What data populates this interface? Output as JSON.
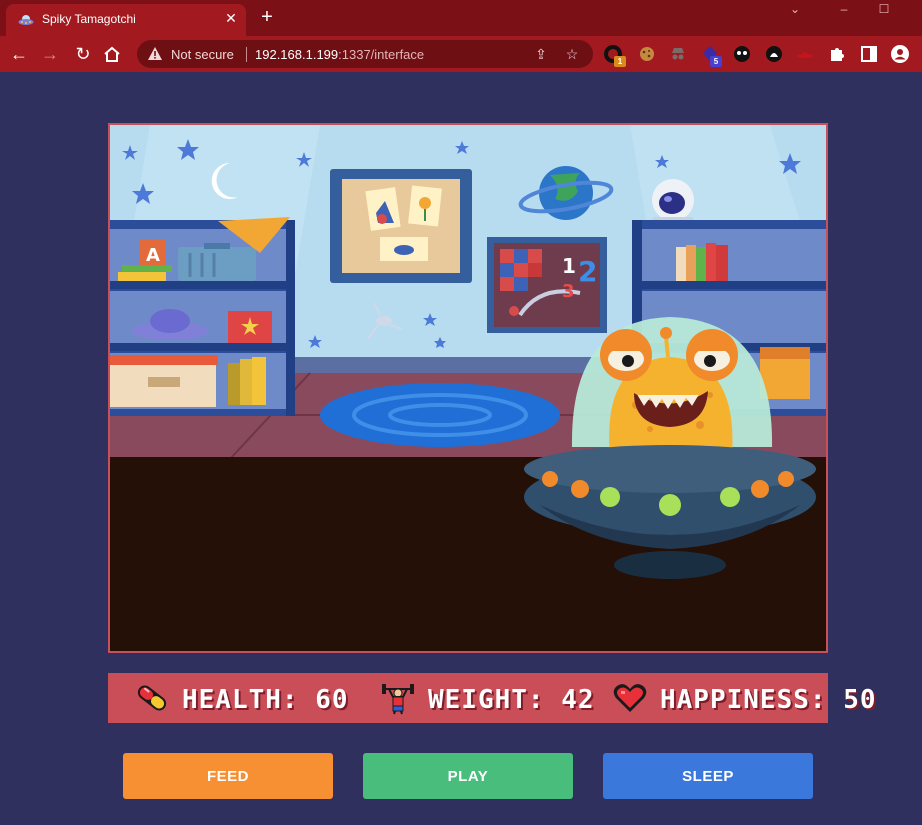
{
  "browser": {
    "tab_title": "Spiky Tamagotchi",
    "security_label": "Not secure",
    "url_host": "192.168.1.199",
    "url_rest": ":1337/interface",
    "extension_badges": [
      "1",
      "5"
    ]
  },
  "stats": {
    "health_label": "HEALTH:",
    "health_value": "60",
    "weight_label": "WEIGHT:",
    "weight_value": "42",
    "happiness_label": "HAPPINESS:",
    "happiness_value": "50"
  },
  "actions": {
    "feed": "FEED",
    "play": "PLAY",
    "sleep": "SLEEP"
  },
  "scene": {
    "clock_numbers": [
      "1",
      "2",
      "3"
    ],
    "toy_block_letter": "A"
  },
  "colors": {
    "page_background": "#30305e",
    "browser_frame": "#a21a1f",
    "stats_bar": "#c94e58",
    "feed_button": "#f78f33",
    "play_button": "#48bd7c",
    "sleep_button": "#3b78db",
    "floor": "#241006"
  },
  "icons": {
    "tab": "ufo-favicon-icon",
    "health": "pill-icon",
    "weight": "weight-lifter-icon",
    "happiness": "heart-icon"
  }
}
